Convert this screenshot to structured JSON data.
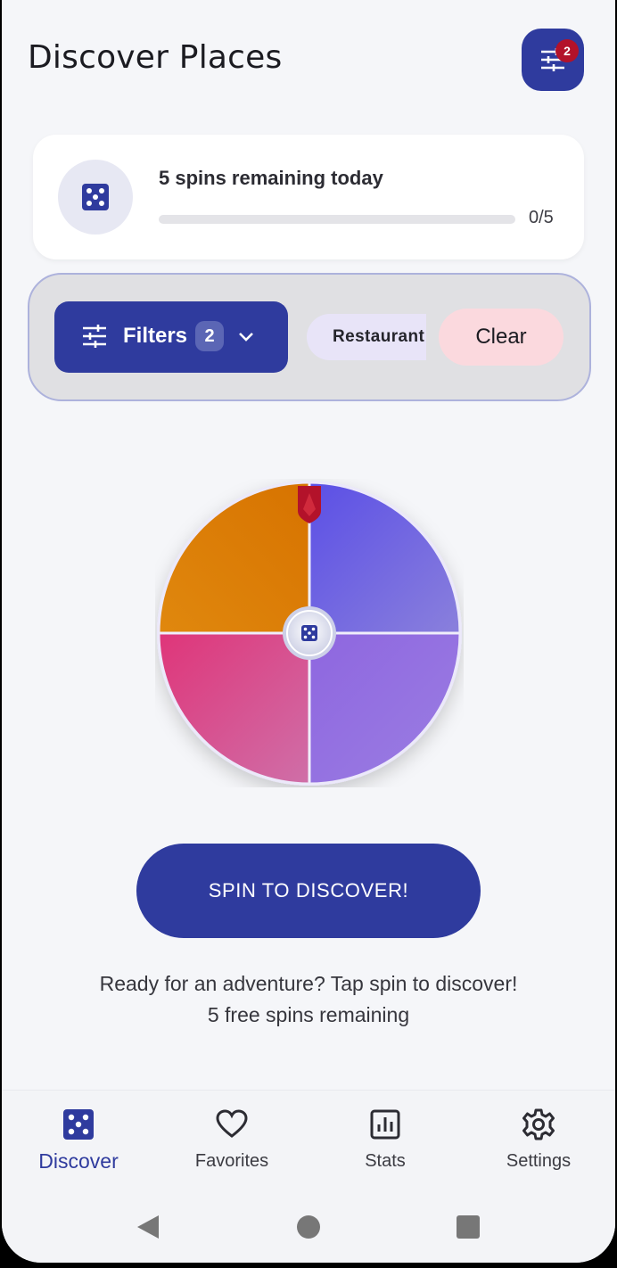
{
  "header": {
    "title": "Discover Places",
    "filter_badge": "2"
  },
  "spins_card": {
    "text": "5 spins remaining today",
    "progress_label": "0/5",
    "progress_fraction": 0
  },
  "filters": {
    "button_label": "Filters",
    "count": "2",
    "chip_label": "Restaurant",
    "clear_label": "Clear"
  },
  "wheel": {
    "segments": [
      {
        "id": "top-left",
        "color": "#db7a0a"
      },
      {
        "id": "top-right",
        "color": "#6a5fe0"
      },
      {
        "id": "bottom-left",
        "color": "#d94f8a"
      },
      {
        "id": "bottom-right",
        "color": "#9672e2"
      }
    ],
    "pointer_color": "#b3122a"
  },
  "spin_button": {
    "label": "SPIN TO DISCOVER!"
  },
  "messages": {
    "line1": "Ready for an adventure? Tap spin to discover!",
    "line2": "5 free spins remaining"
  },
  "nav": {
    "items": [
      {
        "label": "Discover",
        "icon": "dice-icon",
        "active": true
      },
      {
        "label": "Favorites",
        "icon": "heart-icon",
        "active": false
      },
      {
        "label": "Stats",
        "icon": "chart-icon",
        "active": false
      },
      {
        "label": "Settings",
        "icon": "gear-icon",
        "active": false
      }
    ]
  },
  "colors": {
    "primary": "#2f3b9e",
    "background": "#f5f6f9",
    "badge": "#b3122a",
    "clear_bg": "#fbd9de",
    "chip_bg": "#e8e4f8"
  }
}
